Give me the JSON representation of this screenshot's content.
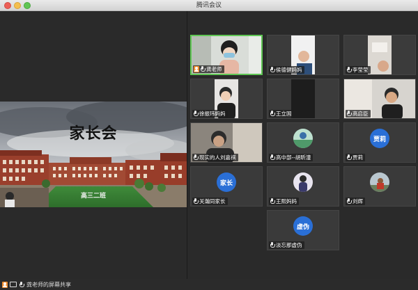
{
  "window": {
    "title": "腾讯会议"
  },
  "slide": {
    "title": "家长会",
    "subtitle": "高三二班"
  },
  "share_status": {
    "label": "龚老师的屏幕共享"
  },
  "participants": [
    {
      "name": "龚老师",
      "avatar_text": "",
      "host": true,
      "speaking": true
    },
    {
      "name": "侯德健妈妈",
      "avatar_text": ""
    },
    {
      "name": "李莹莹",
      "avatar_text": ""
    },
    {
      "name": "徐振玮妈妈",
      "avatar_text": ""
    },
    {
      "name": "王立国",
      "avatar_text": ""
    },
    {
      "name": "高启臣",
      "avatar_text": ""
    },
    {
      "name": "现实的人刘嘉祺",
      "avatar_text": ""
    },
    {
      "name": "高中部--胡昕潼",
      "avatar_text": ""
    },
    {
      "name": "贾莉",
      "avatar_text": "贾莉"
    },
    {
      "name": "关瀚同家长",
      "avatar_text": "家长"
    },
    {
      "name": "王熙妈妈",
      "avatar_text": ""
    },
    {
      "name": "刘辉",
      "avatar_text": ""
    },
    {
      "name": "淡忘那虚伪",
      "avatar_text": "虚伪"
    }
  ],
  "colors": {
    "accent_green": "#5fc654",
    "avatar_blue": "#2a6fd6",
    "host_orange": "#f18b2c"
  }
}
